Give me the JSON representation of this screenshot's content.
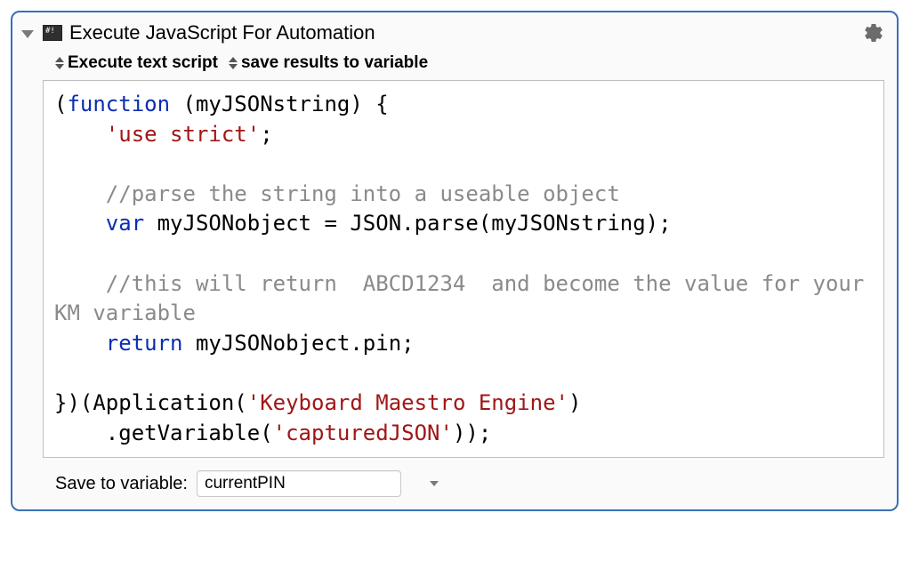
{
  "action": {
    "title": "Execute JavaScript For Automation",
    "hash_label": "#!",
    "popup_mode": "Execute text script",
    "popup_output": "save results to variable",
    "save_label": "Save to variable:",
    "save_variable": "currentPIN",
    "code": {
      "line1_open": "(",
      "line1_func": "function",
      "line1_rest": " (myJSONstring) {",
      "line2_indent": "    ",
      "line2_string": "'use strict'",
      "line2_semi": ";",
      "line3_blank": "",
      "line4_indent": "    ",
      "line4_comment": "//parse the string into a useable object",
      "line5_indent": "    ",
      "line5_var": "var",
      "line5_rest": " myJSONobject = JSON.parse(myJSONstring);",
      "line6_blank": "",
      "line7_indent": "    ",
      "line7_comment": "//this will return  ABCD1234  and become the value for your KM variable",
      "line8_indent": "    ",
      "line8_return": "return",
      "line8_rest": " myJSONobject.pin;",
      "line9_blank": "",
      "line10_close": "})(Application(",
      "line10_string": "'Keyboard Maestro Engine'",
      "line10_after": ")",
      "line11_indent": "    ",
      "line11_call": ".getVariable(",
      "line11_string": "'capturedJSON'",
      "line11_after": "));"
    }
  }
}
